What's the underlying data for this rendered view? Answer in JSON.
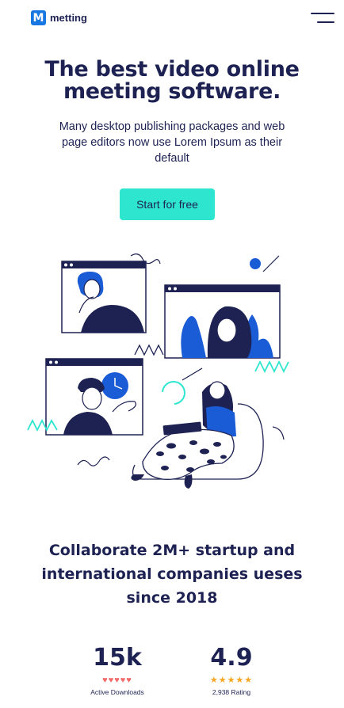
{
  "header": {
    "logo_mark": "M",
    "logo_text": "metting",
    "menu_icon": "hamburger-menu-icon"
  },
  "hero": {
    "title_line1": "The best video online",
    "title_line2": "meeting software.",
    "subtitle": "Many desktop publishing packages and web page editors now use Lorem Ipsum as their default",
    "cta_label": "Start for free"
  },
  "illustration": {
    "icon": "video-meeting-illustration",
    "colors": {
      "navy": "#1d2253",
      "blue": "#1a5bd6",
      "teal": "#2ee6cf"
    }
  },
  "collab": {
    "line1": "Collaborate 2M+ startup and",
    "line2": "international companies ueses",
    "line3": "since 2018"
  },
  "stats": [
    {
      "value": "15k",
      "stars": "♥♥♥♥♥",
      "star_color": "#f26a6a",
      "label": "Active Downloads"
    },
    {
      "value": "4.9",
      "stars": "★★★★★",
      "star_color": "#f5a623",
      "label": "2,938 Rating"
    }
  ],
  "colors": {
    "brand": "#1877e0",
    "text": "#1d2253",
    "accent": "#2ee6cf"
  }
}
